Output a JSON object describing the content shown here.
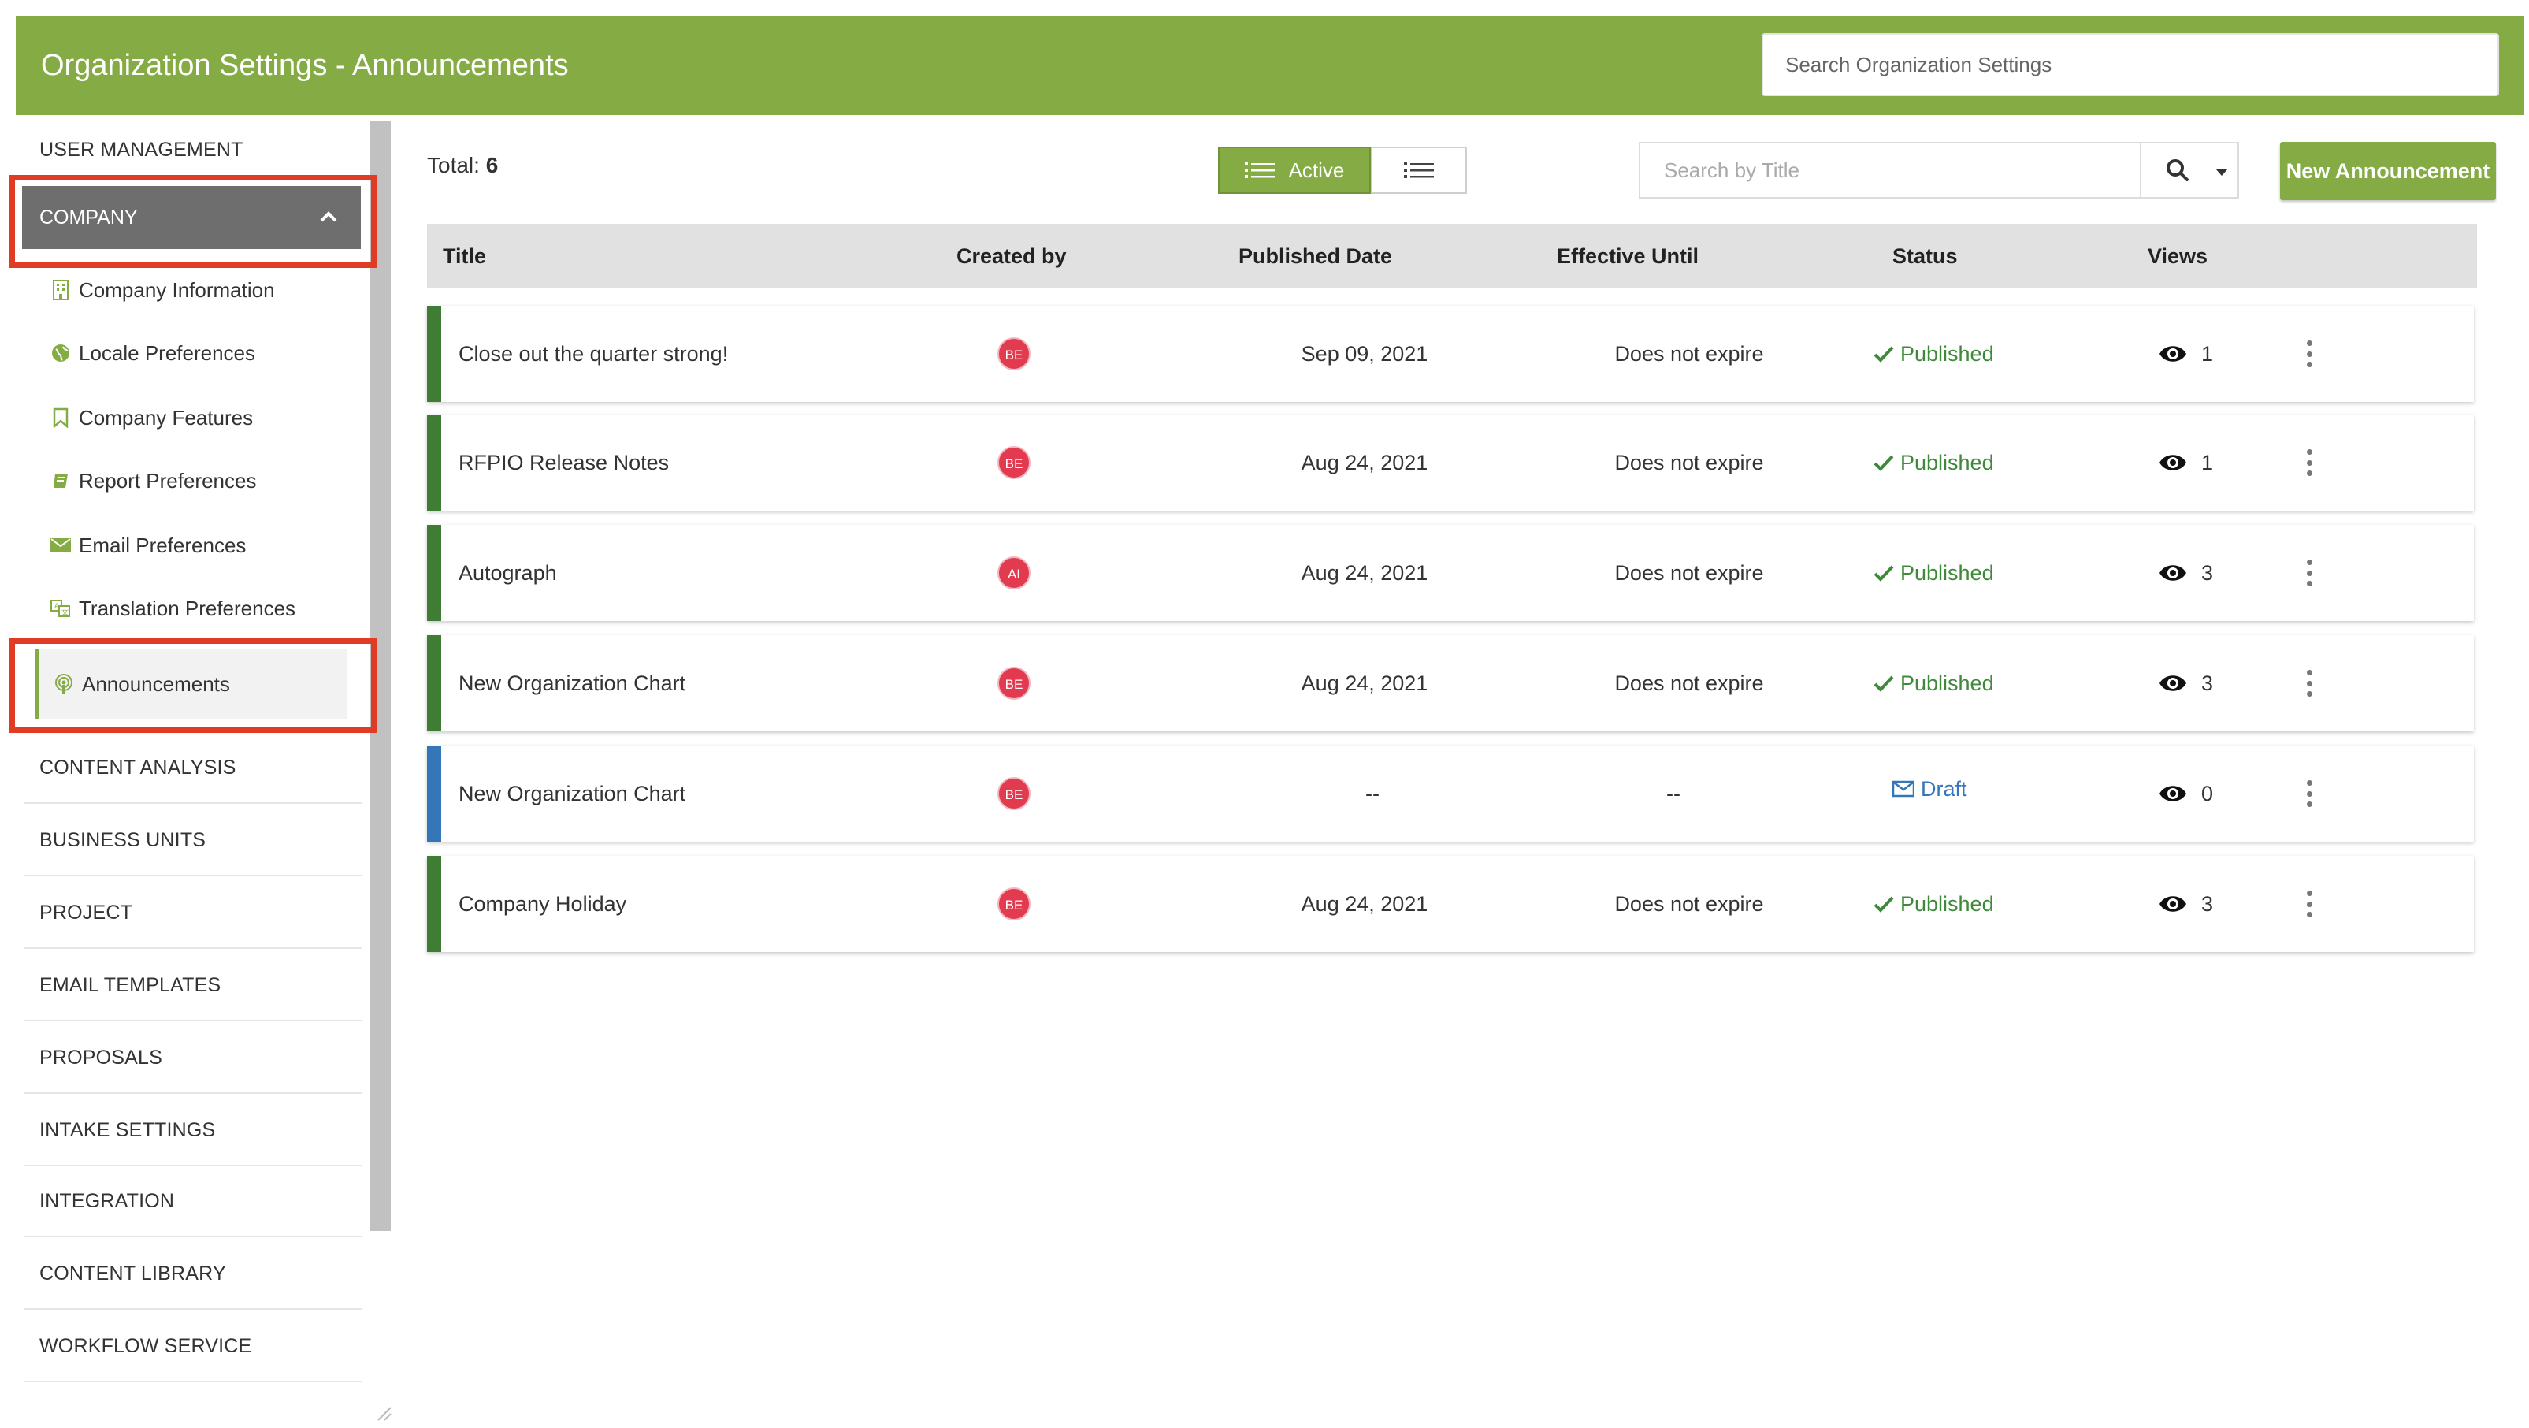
{
  "header": {
    "title": "Organization Settings - Announcements",
    "search_placeholder": "Search Organization Settings"
  },
  "sidebar": {
    "sections_top": [
      {
        "label": "USER MANAGEMENT"
      }
    ],
    "company": {
      "label": "COMPANY",
      "items": [
        {
          "label": "Company Information",
          "icon": "building-icon"
        },
        {
          "label": "Locale Preferences",
          "icon": "globe-icon"
        },
        {
          "label": "Company Features",
          "icon": "bookmark-icon"
        },
        {
          "label": "Report Preferences",
          "icon": "book-icon"
        },
        {
          "label": "Email Preferences",
          "icon": "envelope-icon"
        },
        {
          "label": "Translation Preferences",
          "icon": "translate-icon"
        },
        {
          "label": "Announcements",
          "icon": "podcast-icon",
          "active": true
        }
      ]
    },
    "sections_bottom": [
      {
        "label": "CONTENT ANALYSIS"
      },
      {
        "label": "BUSINESS UNITS"
      },
      {
        "label": "PROJECT"
      },
      {
        "label": "EMAIL TEMPLATES"
      },
      {
        "label": "PROPOSALS"
      },
      {
        "label": "INTAKE SETTINGS"
      },
      {
        "label": "INTEGRATION"
      },
      {
        "label": "CONTENT LIBRARY"
      },
      {
        "label": "WORKFLOW SERVICE"
      }
    ]
  },
  "toolbar": {
    "total_label": "Total:",
    "total_value": "6",
    "active_label": "Active",
    "title_search_placeholder": "Search by Title",
    "new_button": "New Announcement"
  },
  "table": {
    "columns": [
      "Title",
      "Created by",
      "Published Date",
      "Effective Until",
      "Status",
      "Views"
    ],
    "rows": [
      {
        "title": "Close out the quarter strong!",
        "created_by": "BE",
        "published": "Sep 09, 2021",
        "effective": "Does not expire",
        "status": "Published",
        "views": "1"
      },
      {
        "title": "RFPIO Release Notes",
        "created_by": "BE",
        "published": "Aug 24, 2021",
        "effective": "Does not expire",
        "status": "Published",
        "views": "1"
      },
      {
        "title": "Autograph",
        "created_by": "AI",
        "published": "Aug 24, 2021",
        "effective": "Does not expire",
        "status": "Published",
        "views": "3"
      },
      {
        "title": "New Organization Chart",
        "created_by": "BE",
        "published": "Aug 24, 2021",
        "effective": "Does not expire",
        "status": "Published",
        "views": "3"
      },
      {
        "title": "New Organization Chart",
        "created_by": "BE",
        "published": "--",
        "effective": "--",
        "status": "Draft",
        "views": "0"
      },
      {
        "title": "Company Holiday",
        "created_by": "BE",
        "published": "Aug 24, 2021",
        "effective": "Does not expire",
        "status": "Published",
        "views": "3"
      }
    ]
  },
  "colors": {
    "brand_green": "#85ac44",
    "published_green": "#3f8a3a",
    "draft_blue": "#3476b8",
    "highlight_red": "#e03b24",
    "avatar_red": "#e23a4f"
  }
}
